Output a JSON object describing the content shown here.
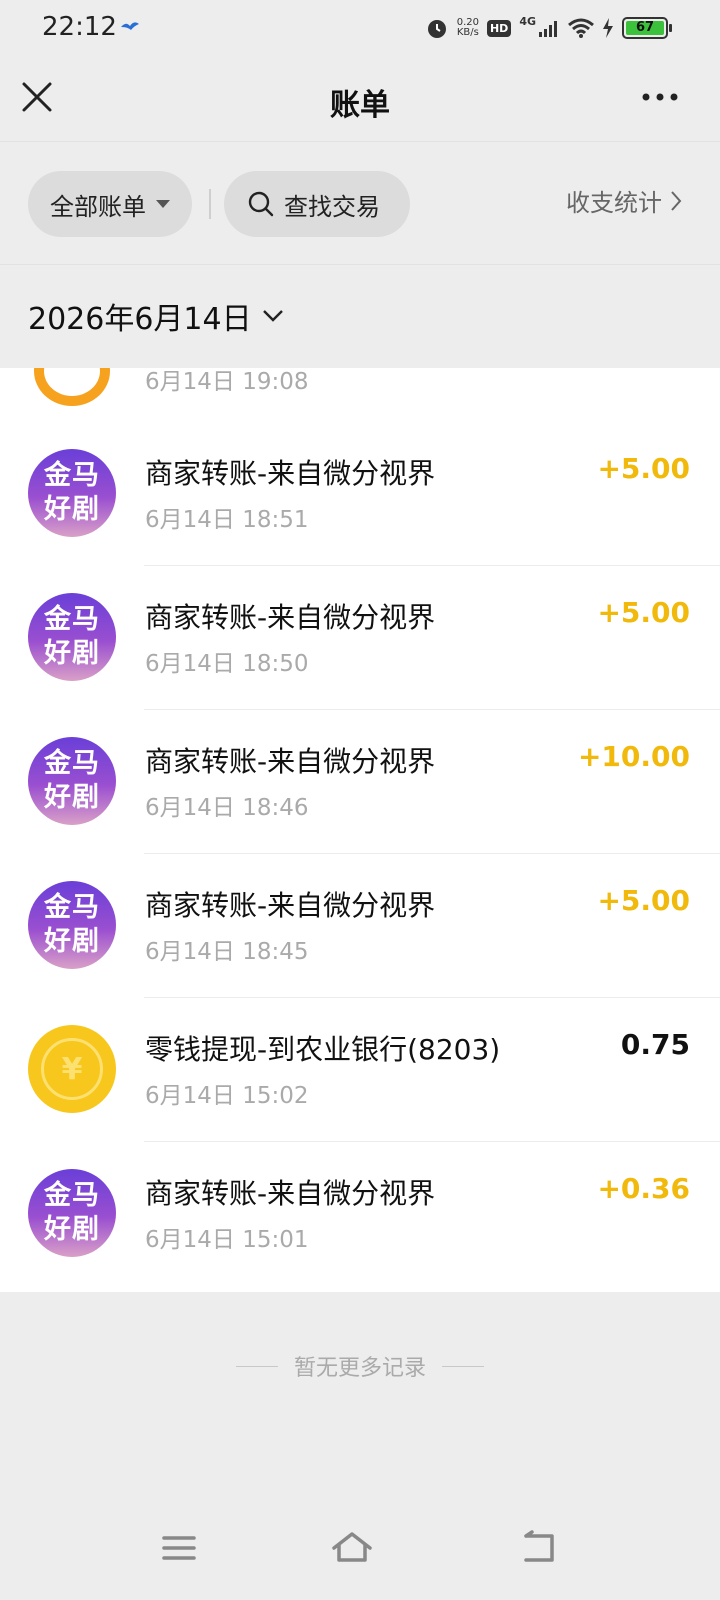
{
  "status_bar": {
    "time": "22:12",
    "net_speed_value": "0.20",
    "net_speed_unit": "KB/s",
    "hd": "HD",
    "network": "4G",
    "battery": "67"
  },
  "header": {
    "title": "账单"
  },
  "filters": {
    "all_bills_label": "全部账单",
    "search_label": "查找交易",
    "stats_label": "收支统计"
  },
  "date_header": {
    "label": "2026年6月14日"
  },
  "partial_row": {
    "time": "6月14日 19:08"
  },
  "transactions": [
    {
      "title": "商家转账-来自微分视界",
      "time": "6月14日 18:51",
      "amount": "+5.00",
      "avatar_text": [
        "金马",
        "好剧"
      ]
    },
    {
      "title": "商家转账-来自微分视界",
      "time": "6月14日 18:50",
      "amount": "+5.00",
      "avatar_text": [
        "金马",
        "好剧"
      ]
    },
    {
      "title": "商家转账-来自微分视界",
      "time": "6月14日 18:46",
      "amount": "+10.00",
      "avatar_text": [
        "金马",
        "好剧"
      ]
    },
    {
      "title": "商家转账-来自微分视界",
      "time": "6月14日 18:45",
      "amount": "+5.00",
      "avatar_text": [
        "金马",
        "好剧"
      ]
    },
    {
      "title": "零钱提现-到农业银行(8203)",
      "time": "6月14日 15:02",
      "amount": "0.75",
      "avatar_text": [
        "¥"
      ]
    },
    {
      "title": "商家转账-来自微分视界",
      "time": "6月14日 15:01",
      "amount": "+0.36",
      "avatar_text": [
        "金马",
        "好剧"
      ]
    }
  ],
  "footer": {
    "no_more": "暂无更多记录"
  },
  "colors": {
    "income": "#f0b90b",
    "background": "#ededed",
    "coin": "#f8c71d"
  }
}
